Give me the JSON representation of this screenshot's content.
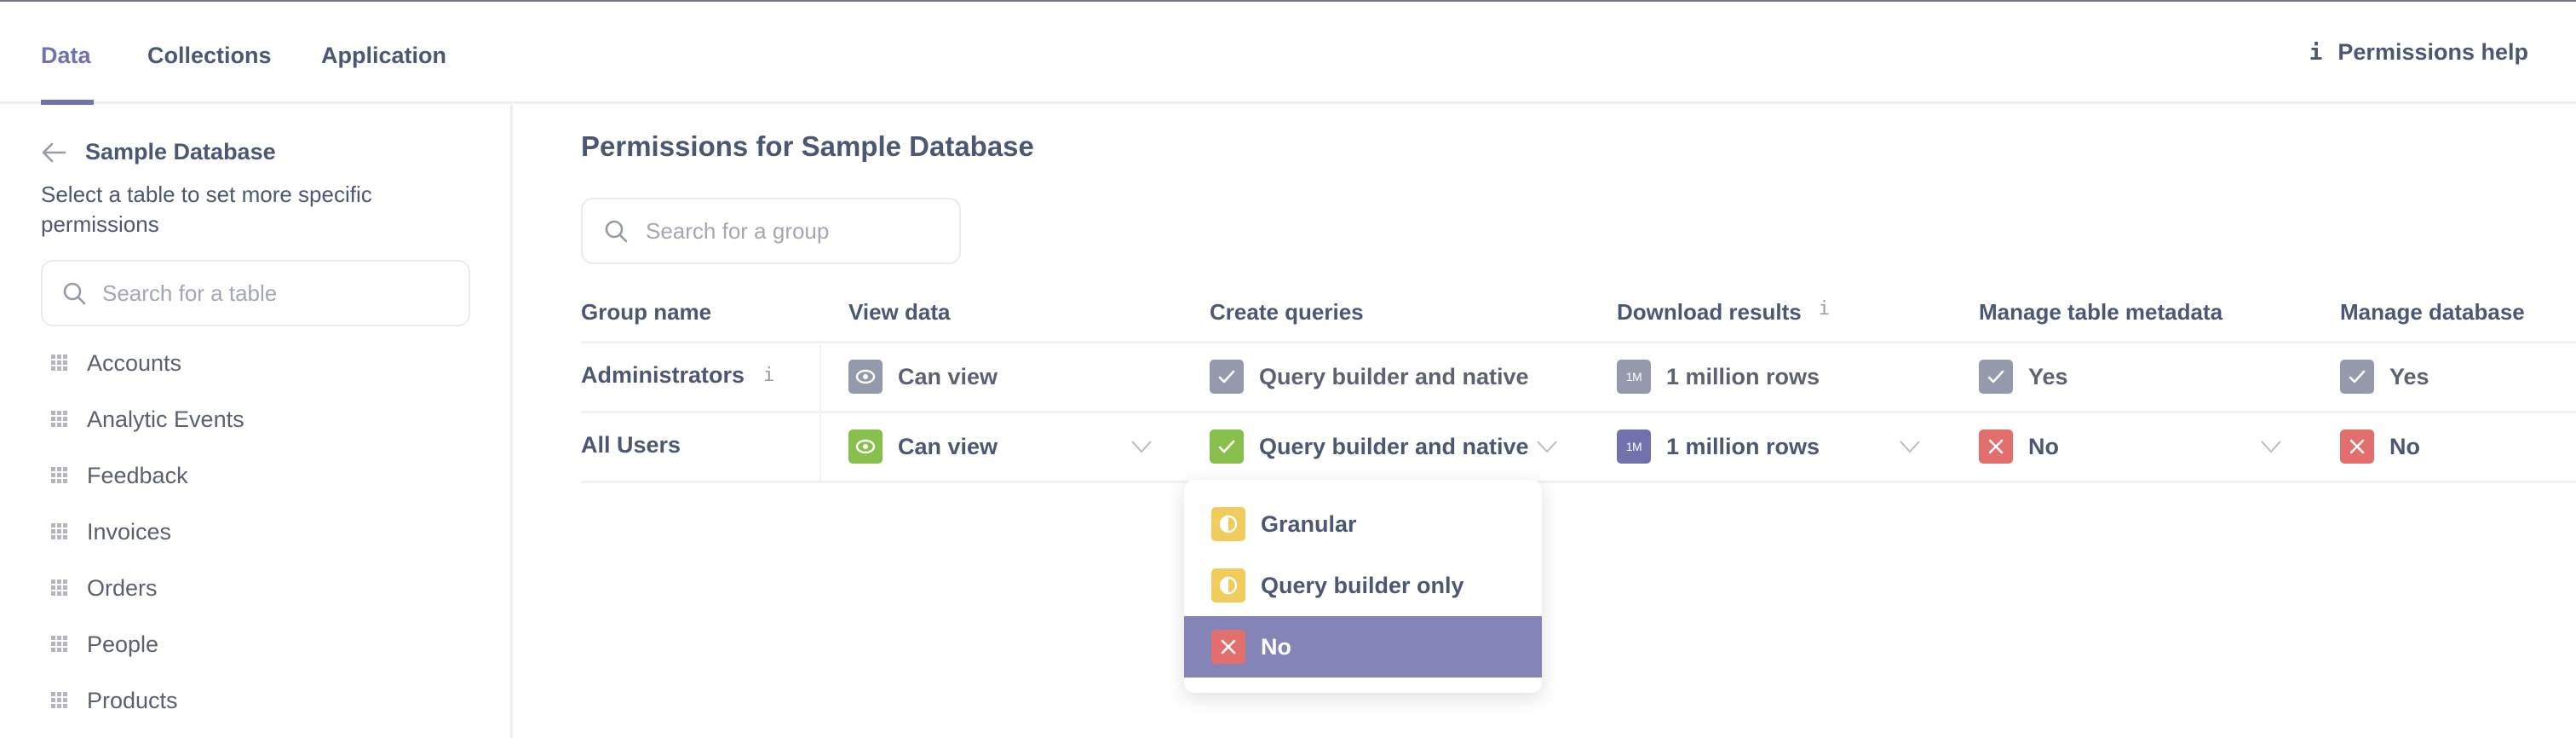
{
  "header": {
    "tabs": [
      {
        "label": "Data",
        "active": true
      },
      {
        "label": "Collections",
        "active": false
      },
      {
        "label": "Application",
        "active": false
      }
    ],
    "help_label": "Permissions help",
    "help_icon": "info-icon"
  },
  "sidebar": {
    "back_icon": "arrow-left-icon",
    "database_name": "Sample Database",
    "description": "Select a table to set more specific permissions",
    "search": {
      "placeholder": "Search for a table",
      "value": ""
    },
    "tables": [
      {
        "label": "Accounts",
        "icon": "table-grid-icon"
      },
      {
        "label": "Analytic Events",
        "icon": "table-grid-icon"
      },
      {
        "label": "Feedback",
        "icon": "table-grid-icon"
      },
      {
        "label": "Invoices",
        "icon": "table-grid-icon"
      },
      {
        "label": "Orders",
        "icon": "table-grid-icon"
      },
      {
        "label": "People",
        "icon": "table-grid-icon"
      },
      {
        "label": "Products",
        "icon": "table-grid-icon"
      }
    ]
  },
  "main": {
    "title": "Permissions for Sample Database",
    "search": {
      "placeholder": "Search for a group",
      "value": ""
    },
    "columns": [
      {
        "label": "Group name"
      },
      {
        "label": "View data"
      },
      {
        "label": "Create queries"
      },
      {
        "label": "Download results",
        "info": true
      },
      {
        "label": "Manage table metadata"
      },
      {
        "label": "Manage database"
      }
    ],
    "rows": [
      {
        "group": "Administrators",
        "info": true,
        "editable": false,
        "view_data": {
          "label": "Can view",
          "icon": "eye-icon",
          "color": "#949aab"
        },
        "create_queries": {
          "label": "Query builder and native",
          "icon": "check-icon",
          "color": "#949aab"
        },
        "download_results": {
          "label": "1 million rows",
          "icon": "1M",
          "color": "#949aab"
        },
        "manage_table_metadata": {
          "label": "Yes",
          "icon": "check-icon",
          "color": "#949aab"
        },
        "manage_database": {
          "label": "Yes",
          "icon": "check-icon",
          "color": "#949aab"
        }
      },
      {
        "group": "All Users",
        "info": false,
        "editable": true,
        "view_data": {
          "label": "Can view",
          "icon": "eye-icon",
          "color": "#88bf4d"
        },
        "create_queries": {
          "label": "Query builder and native",
          "icon": "check-icon",
          "color": "#88bf4d"
        },
        "download_results": {
          "label": "1 million rows",
          "icon": "1M",
          "color": "#7172ad"
        },
        "manage_table_metadata": {
          "label": "No",
          "icon": "close-icon",
          "color": "#e36e6e"
        },
        "manage_database": {
          "label": "No",
          "icon": "close-icon",
          "color": "#e36e6e"
        }
      }
    ]
  },
  "dropdown": {
    "for": "All Users / Create queries",
    "options": [
      {
        "label": "Granular",
        "icon": "partial-circle-icon",
        "color": "#f0cc5c",
        "selected": false
      },
      {
        "label": "Query builder only",
        "icon": "partial-circle-icon",
        "color": "#f0cc5c",
        "selected": false
      },
      {
        "label": "No",
        "icon": "close-icon",
        "color": "#e36e6e",
        "selected": true
      }
    ],
    "selected_bg": "#8584b6"
  }
}
